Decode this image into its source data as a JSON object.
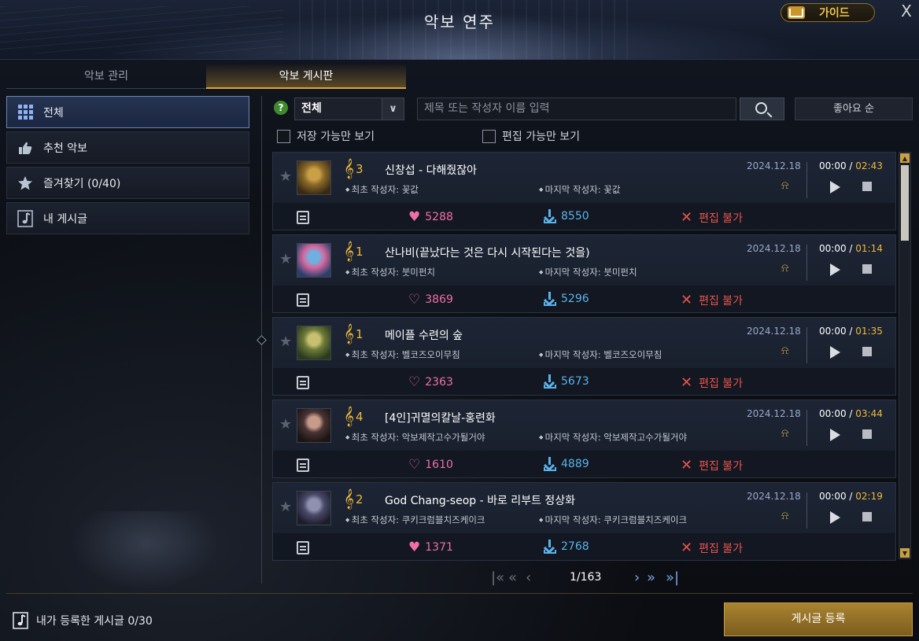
{
  "header": {
    "title": "악보 연주",
    "guide_label": "가이드",
    "close_label": "X"
  },
  "tabs": [
    {
      "label": "악보 관리",
      "active": false
    },
    {
      "label": "악보 게시판",
      "active": true
    }
  ],
  "sidebar": {
    "items": [
      {
        "label": "전체",
        "icon": "grid-icon",
        "active": true
      },
      {
        "label": "추천 악보",
        "icon": "thumbs-up-icon",
        "active": false
      },
      {
        "label": "즐겨찾기 (0/40)",
        "icon": "star-icon",
        "active": false
      },
      {
        "label": "내 게시글",
        "icon": "music-note-icon",
        "active": false
      }
    ]
  },
  "filter": {
    "help": "?",
    "category_value": "전체",
    "search_placeholder": "제목 또는 작성자 이름 입력",
    "sort_label": "좋아요 순",
    "check_saveable": "저장 가능만 보기",
    "check_editable": "편집 가능만 보기"
  },
  "rows": [
    {
      "players": "3",
      "title": "신창섭 - 다해줬잖아",
      "date": "2024.12.18",
      "author": "최초 작성자: 꽃값",
      "last_author": "마지막 작성자: 꽃값",
      "elapsed": "00:00",
      "total": "02:43",
      "likes": "5288",
      "liked": true,
      "downloads": "8550",
      "edit_status": "편집 불가"
    },
    {
      "players": "1",
      "title": "산나비(끝났다는 것은 다시 시작된다는 것을)",
      "date": "2024.12.18",
      "author": "최초 작성자: 붓미펀치",
      "last_author": "마지막 작성자: 붓미펀치",
      "elapsed": "00:00",
      "total": "01:14",
      "likes": "3869",
      "liked": false,
      "downloads": "5296",
      "edit_status": "편집 불가"
    },
    {
      "players": "1",
      "title": "메이플 수련의 숲",
      "date": "2024.12.18",
      "author": "최초 작성자: 벨코즈오이무침",
      "last_author": "마지막 작성자: 벨코즈오이무침",
      "elapsed": "00:00",
      "total": "01:35",
      "likes": "2363",
      "liked": false,
      "downloads": "5673",
      "edit_status": "편집 불가"
    },
    {
      "players": "4",
      "title": "[4인]귀멸의칼날-홍련화",
      "date": "2024.12.18",
      "author": "최초 작성자: 악보제작고수가될거야",
      "last_author": "마지막 작성자: 악보제작고수가될거야",
      "elapsed": "00:00",
      "total": "03:44",
      "likes": "1610",
      "liked": false,
      "downloads": "4889",
      "edit_status": "편집 불가"
    },
    {
      "players": "2",
      "title": "God Chang-seop - 바로 리부트 정상화",
      "date": "2024.12.18",
      "author": "최초 작성자: 쿠키크럼블치즈케이크",
      "last_author": "마지막 작성자: 쿠키크럼블치즈케이크",
      "elapsed": "00:00",
      "total": "02:19",
      "likes": "1371",
      "liked": true,
      "downloads": "2768",
      "edit_status": "편집 불가"
    }
  ],
  "pagination": {
    "text": "1/163"
  },
  "footer": {
    "my_posts": "내가 등록한 게시글 0/30",
    "register_label": "게시글 등록"
  },
  "colors": {
    "accent_gold": "#f0b93a",
    "like_pink": "#f06fa8",
    "download_blue": "#5ab3ea",
    "edit_red": "#e8554c",
    "selected_blue": "#6b86b8"
  }
}
